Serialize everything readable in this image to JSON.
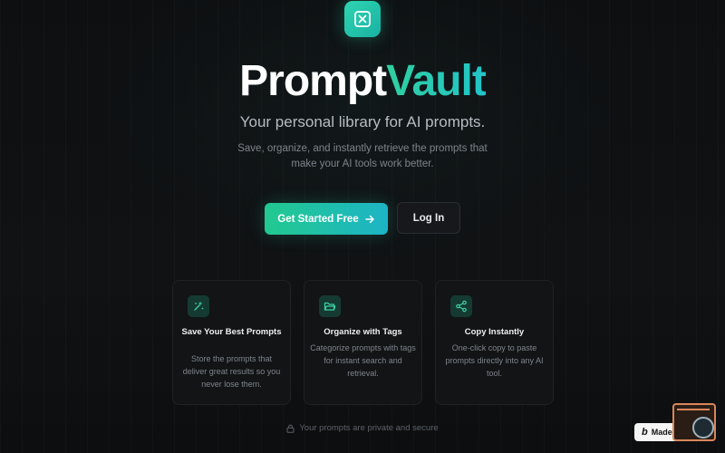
{
  "brand": {
    "name_part1": "Prompt",
    "name_part2": "Vault",
    "logo_icon": "x-box-icon"
  },
  "hero": {
    "subtitle": "Your personal library for AI prompts.",
    "description": "Save, organize, and instantly retrieve the prompts that make your AI tools work better."
  },
  "actions": {
    "primary_label": "Get Started Free",
    "primary_icon": "arrow-right-icon",
    "secondary_label": "Log In"
  },
  "features": [
    {
      "icon": "sparkles-icon",
      "title": "Save Your Best Prompts",
      "description": "Store the prompts that deliver great results so you never lose them."
    },
    {
      "icon": "folder-open-icon",
      "title": "Organize with Tags",
      "description": "Categorize prompts with tags for instant search and retrieval."
    },
    {
      "icon": "share-icon",
      "title": "Copy Instantly",
      "description": "One-click copy to paste prompts directly into any AI tool."
    }
  ],
  "footer": {
    "privacy_text": "Your prompts are private and secure",
    "privacy_icon": "lock-icon"
  },
  "badge": {
    "logo_letter": "b",
    "label": "Made in B"
  },
  "colors": {
    "accent_start": "#22c98f",
    "accent_end": "#1db4c6",
    "background": "#0c0d0f"
  }
}
